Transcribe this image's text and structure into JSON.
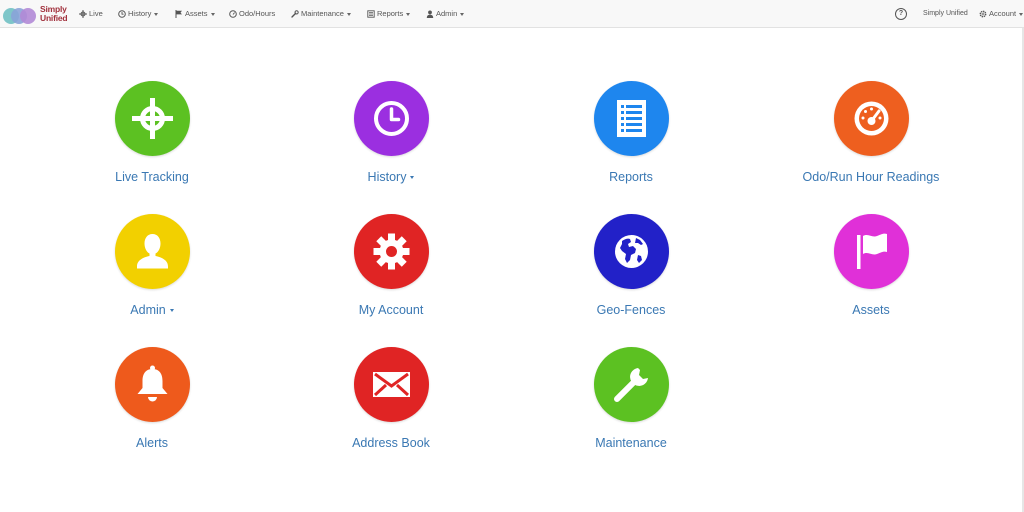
{
  "brand": {
    "line1": "Simply",
    "line2": "Unified"
  },
  "nav": {
    "live": "Live",
    "history": "History",
    "assets": "Assets",
    "odo_hours": "Odo/Hours",
    "maintenance": "Maintenance",
    "reports": "Reports",
    "admin": "Admin",
    "help": "?",
    "account_name": "Simply Unified",
    "account": "Account"
  },
  "tiles": [
    {
      "label": "Live Tracking",
      "icon": "crosshair-icon",
      "color": "#5cc122"
    },
    {
      "label": "History",
      "icon": "clock-icon",
      "color": "#9b2fe0",
      "dropdown": true
    },
    {
      "label": "Reports",
      "icon": "list-report-icon",
      "color": "#1e86ee"
    },
    {
      "label": "Odo/Run Hour Readings",
      "icon": "dashboard-gauge-icon",
      "color": "#ee5f1f"
    },
    {
      "label": "Admin",
      "icon": "user-icon",
      "color": "#f2d000",
      "dropdown": true
    },
    {
      "label": "My Account",
      "icon": "gear-icon",
      "color": "#e02424"
    },
    {
      "label": "Geo-Fences",
      "icon": "globe-icon",
      "color": "#2221c8"
    },
    {
      "label": "Assets",
      "icon": "flag-icon",
      "color": "#e030d8"
    },
    {
      "label": "Alerts",
      "icon": "bell-icon",
      "color": "#ee5a1c"
    },
    {
      "label": "Address Book",
      "icon": "envelope-icon",
      "color": "#e02424"
    },
    {
      "label": "Maintenance",
      "icon": "wrench-icon",
      "color": "#5cc122"
    }
  ]
}
